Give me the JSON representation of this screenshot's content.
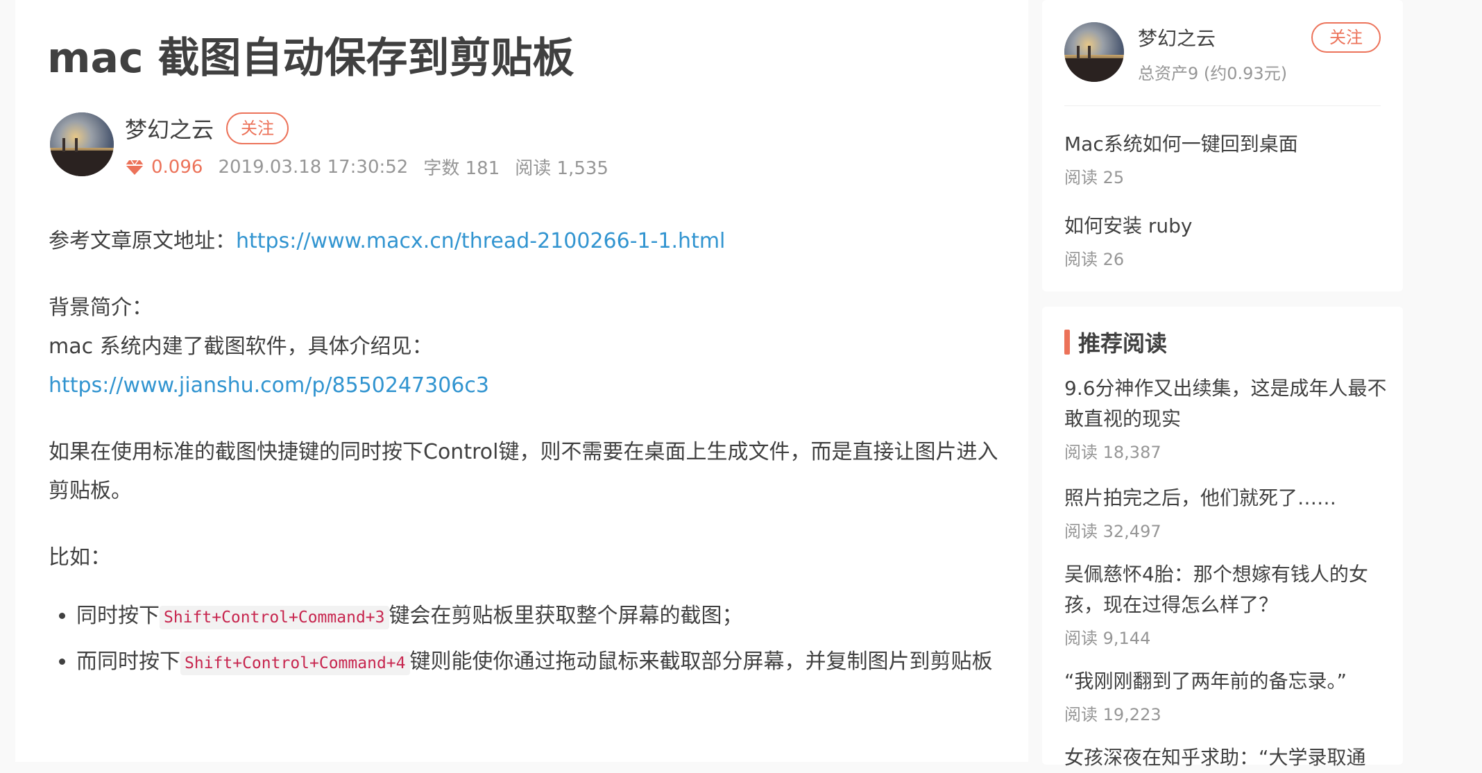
{
  "article": {
    "title": "mac 截图自动保存到剪贴板",
    "author": "梦幻之云",
    "follow_label": "关注",
    "diamond_value": "0.096",
    "datetime": "2019.03.18 17:30:52",
    "word_count": "字数 181",
    "reads": "阅读 1,535",
    "ref_label": "参考文章原文地址：",
    "ref_link": "https://www.macx.cn/thread-2100266-1-1.html",
    "bg_label": "背景简介：",
    "bg_text": "mac 系统内建了截图软件，具体介绍见：",
    "bg_link": "https://www.jianshu.com/p/8550247306c3",
    "para": "如果在使用标准的截图快捷键的同时按下Control键，则不需要在桌面上生成文件，而是直接让图片进入剪贴板。",
    "example_label": "比如：",
    "list": [
      {
        "prefix": "同时按下",
        "code": "Shift+Control+Command+3",
        "suffix": "键会在剪贴板里获取整个屏幕的截图；"
      },
      {
        "prefix": "而同时按下",
        "code": "Shift+Control+Command+4",
        "suffix": "键则能使你通过拖动鼠标来截取部分屏幕，并复制图片到剪贴板"
      }
    ]
  },
  "sidebar": {
    "author_name": "梦幻之云",
    "assets": "总资产9 (约0.93元)",
    "follow_label": "关注",
    "author_articles": [
      {
        "title": "Mac系统如何一键回到桌面",
        "reads": "阅读 25"
      },
      {
        "title": "如何安装 ruby",
        "reads": "阅读 26"
      }
    ],
    "recommend_title": "推荐阅读",
    "recommend": [
      {
        "title": "9.6分神作又出续集，这是成年人最不敢直视的现实",
        "reads": "阅读 18,387"
      },
      {
        "title": "照片拍完之后，他们就死了……",
        "reads": "阅读 32,497"
      },
      {
        "title": "吴佩慈怀4胎：那个想嫁有钱人的女孩，现在过得怎么样了？",
        "reads": "阅读 9,144"
      },
      {
        "title": "“我刚刚翻到了两年前的备忘录。”",
        "reads": "阅读 19,223"
      },
      {
        "title": "女孩深夜在知乎求助：“大学录取通",
        "reads": ""
      }
    ]
  },
  "colors": {
    "accent": "#ec7259",
    "link": "#3194d0",
    "code": "#c7254e"
  }
}
